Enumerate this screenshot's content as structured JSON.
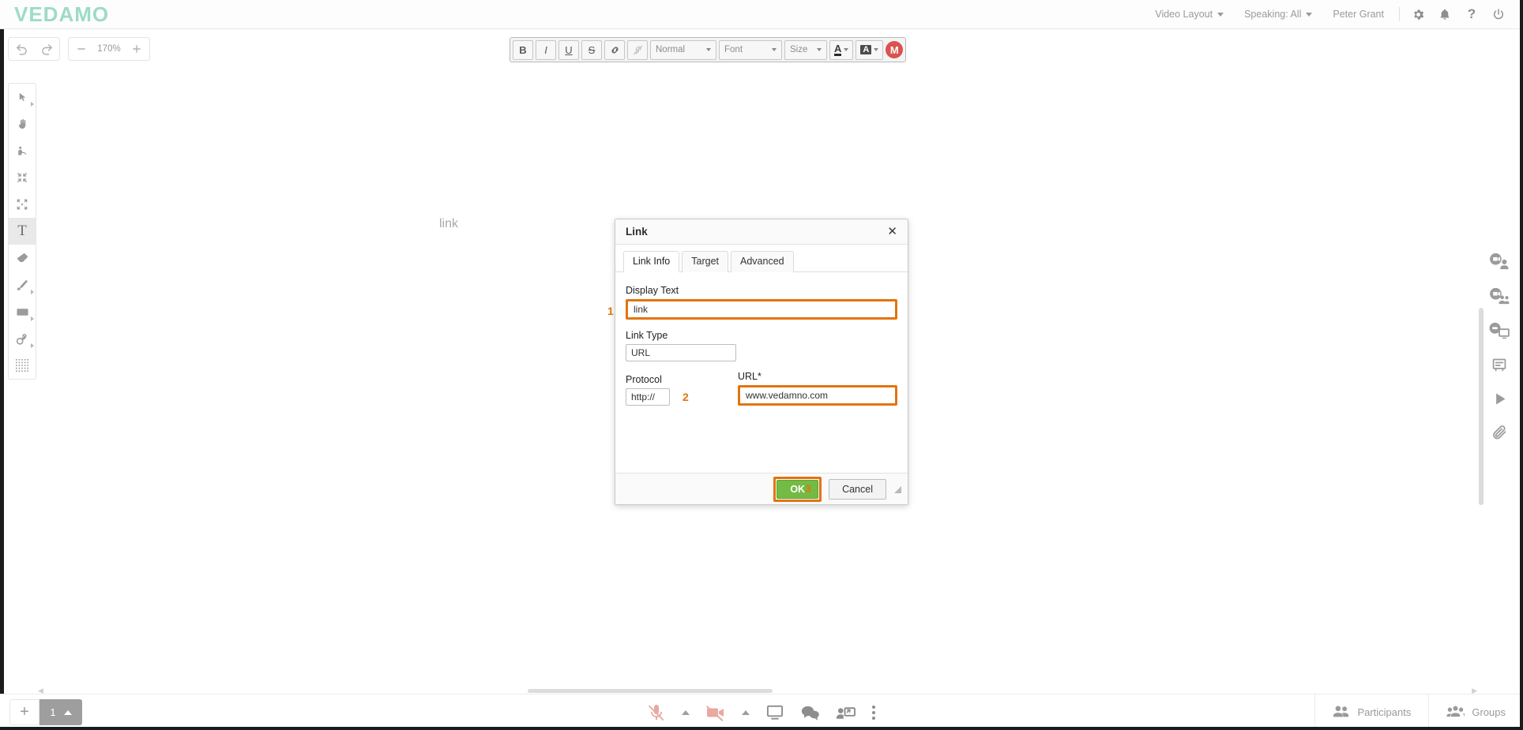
{
  "app": {
    "logo_text": "VEDAMO"
  },
  "header": {
    "video_layout": "Video Layout",
    "speaking": "Speaking: All",
    "user_name": "Peter Grant",
    "icons": {
      "settings": "gear-icon",
      "notifications": "bell-icon",
      "help": "question-icon",
      "power": "power-icon"
    }
  },
  "topleft": {
    "undo": "undo-icon",
    "redo": "redo-icon",
    "zoom_out": "−",
    "zoom_level": "170%",
    "zoom_in": "+"
  },
  "rte_toolbar": {
    "bold": "B",
    "italic": "I",
    "underline": "U",
    "strike": "S",
    "link": "link-icon",
    "unlink": "unlink-icon",
    "format": "Normal",
    "font": "Font",
    "size": "Size",
    "text_color": "A",
    "bg_color": "A",
    "brand": "M"
  },
  "left_tools": [
    {
      "name": "select-tool",
      "glyph": "cursor",
      "has_submenu": true,
      "active": false
    },
    {
      "name": "pan-tool",
      "glyph": "hand",
      "has_submenu": false,
      "active": false
    },
    {
      "name": "pointer-tool",
      "glyph": "pointer",
      "has_submenu": false,
      "active": false
    },
    {
      "name": "group-tool",
      "glyph": "collapse",
      "has_submenu": false,
      "active": false
    },
    {
      "name": "ungroup-tool",
      "glyph": "expand",
      "has_submenu": false,
      "active": false
    },
    {
      "name": "text-tool",
      "glyph": "T",
      "has_submenu": false,
      "active": true
    },
    {
      "name": "eraser-tool",
      "glyph": "eraser",
      "has_submenu": false,
      "active": false
    },
    {
      "name": "brush-tool",
      "glyph": "brush",
      "has_submenu": true,
      "active": false
    },
    {
      "name": "shape-tool",
      "glyph": "rect",
      "has_submenu": true,
      "active": false
    },
    {
      "name": "stamp-tool",
      "glyph": "stamp",
      "has_submenu": true,
      "active": false
    },
    {
      "name": "grid-tool",
      "glyph": "grid",
      "has_submenu": false,
      "active": false
    }
  ],
  "right_tools": [
    {
      "name": "record-person-icon"
    },
    {
      "name": "record-group-icon"
    },
    {
      "name": "record-screen-icon"
    },
    {
      "name": "notes-icon"
    },
    {
      "name": "media-play-icon"
    },
    {
      "name": "attachment-icon"
    }
  ],
  "canvas": {
    "link_text": "link"
  },
  "dialog": {
    "title": "Link",
    "close": "✕",
    "tabs": [
      {
        "label": "Link Info",
        "active": true
      },
      {
        "label": "Target",
        "active": false
      },
      {
        "label": "Advanced",
        "active": false
      }
    ],
    "display_text_label": "Display Text",
    "display_text_value": "link",
    "link_type_label": "Link Type",
    "link_type_value": "URL",
    "protocol_label": "Protocol",
    "protocol_value": "http://",
    "url_label": "URL*",
    "url_value": "www.vedamno.com",
    "ok_label": "OK",
    "cancel_label": "Cancel",
    "steps": {
      "one": "1",
      "two": "2",
      "three": "3"
    }
  },
  "bottom": {
    "add_page": "+",
    "page_number": "1",
    "mic": "mic-muted-icon",
    "camera": "camera-muted-icon",
    "screen_share": "screen-icon",
    "chat": "chat-icon",
    "share_to_person": "share-screen-person-icon",
    "more": "more-vertical-icon",
    "participants_label": "Participants",
    "groups_label": "Groups"
  },
  "colors": {
    "brand": "#9ddcc4",
    "highlight": "#e2740f",
    "ok_green": "#73bb44",
    "muted_red": "#e8a9a0"
  }
}
